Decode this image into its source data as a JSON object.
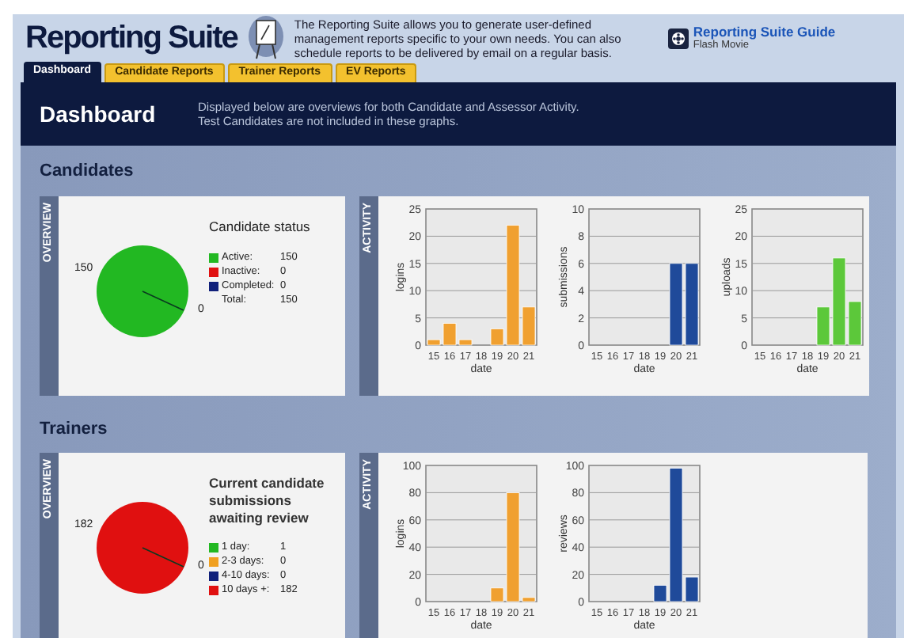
{
  "header": {
    "title": "Reporting Suite",
    "description": "The Reporting Suite allows you to generate user-defined\nmanagement reports specific to your own needs. You can also\nschedule reports to be delivered by email on a regular basis.",
    "guide_link": "Reporting Suite Guide",
    "guide_subtitle": "Flash Movie"
  },
  "tabs": [
    {
      "label": "Dashboard",
      "selected": true
    },
    {
      "label": "Candidate Reports",
      "selected": false
    },
    {
      "label": "Trainer Reports",
      "selected": false
    },
    {
      "label": "EV Reports",
      "selected": false
    }
  ],
  "banner": {
    "title": "Dashboard",
    "description": "Displayed below are overviews for both Candidate and Assessor Activity.\nTest Candidates are not included in these graphs."
  },
  "sections": [
    {
      "title": "Candidates",
      "overview": {
        "label": "OVERVIEW",
        "pie_labels": [
          "150",
          "0"
        ],
        "legend_title": "Candidate status",
        "legend": [
          {
            "label": "Active:",
            "value": "150",
            "color": "#22b822"
          },
          {
            "label": "Inactive:",
            "value": "0",
            "color": "#e01010"
          },
          {
            "label": "Completed:",
            "value": "0",
            "color": "#10207a"
          }
        ],
        "total": {
          "label": "Total:",
          "value": "150"
        }
      },
      "activity": {
        "label": "ACTIVITY",
        "charts": [
          {
            "chart_data": {
              "type": "bar",
              "xlabel": "date",
              "ylabel": "logins",
              "categories": [
                "15",
                "16",
                "17",
                "18",
                "19",
                "20",
                "21"
              ],
              "series": [
                {
                  "color": "#f0a030",
                  "values": [
                    1,
                    4,
                    1,
                    0,
                    3,
                    22,
                    7
                  ]
                }
              ],
              "grid": true,
              "ylim": [
                0,
                25
              ],
              "yticks": [
                0,
                5,
                10,
                15,
                20,
                25
              ]
            }
          },
          {
            "chart_data": {
              "type": "bar",
              "xlabel": "date",
              "ylabel": "submissions",
              "categories": [
                "15",
                "16",
                "17",
                "18",
                "19",
                "20",
                "21"
              ],
              "series": [
                {
                  "color": "#1f4a9a",
                  "values": [
                    0,
                    0,
                    0,
                    0,
                    0,
                    6,
                    6
                  ]
                }
              ],
              "grid": true,
              "ylim": [
                0,
                10
              ],
              "yticks": [
                0,
                2,
                4,
                6,
                8,
                10
              ]
            }
          },
          {
            "chart_data": {
              "type": "bar",
              "xlabel": "date",
              "ylabel": "uploads",
              "categories": [
                "15",
                "16",
                "17",
                "18",
                "19",
                "20",
                "21"
              ],
              "series": [
                {
                  "color": "#5cc83a",
                  "values": [
                    0,
                    0,
                    0,
                    0,
                    7,
                    16,
                    8
                  ]
                }
              ],
              "grid": true,
              "ylim": [
                0,
                25
              ],
              "yticks": [
                0,
                5,
                10,
                15,
                20,
                25
              ]
            }
          }
        ]
      }
    },
    {
      "title": "Trainers",
      "overview": {
        "label": "OVERVIEW",
        "pie_labels": [
          "182",
          "0"
        ],
        "legend_title": "Current candidate submissions awaiting review",
        "legend": [
          {
            "label": "1 day:",
            "value": "1",
            "color": "#22b822"
          },
          {
            "label": "2-3 days:",
            "value": "0",
            "color": "#f0a020"
          },
          {
            "label": "4-10 days:",
            "value": "0",
            "color": "#10207a"
          },
          {
            "label": "10 days +:",
            "value": "182",
            "color": "#e01010"
          }
        ]
      },
      "activity": {
        "label": "ACTIVITY",
        "charts": [
          {
            "chart_data": {
              "type": "bar",
              "xlabel": "date",
              "ylabel": "logins",
              "categories": [
                "15",
                "16",
                "17",
                "18",
                "19",
                "20",
                "21"
              ],
              "series": [
                {
                  "color": "#f0a030",
                  "values": [
                    0,
                    0,
                    0,
                    0,
                    10,
                    80,
                    3
                  ]
                }
              ],
              "grid": true,
              "ylim": [
                0,
                100
              ],
              "yticks": [
                0,
                20,
                40,
                60,
                80,
                100
              ]
            }
          },
          {
            "chart_data": {
              "type": "bar",
              "xlabel": "date",
              "ylabel": "reviews",
              "categories": [
                "15",
                "16",
                "17",
                "18",
                "19",
                "20",
                "21"
              ],
              "series": [
                {
                  "color": "#1f4a9a",
                  "values": [
                    0,
                    0,
                    0,
                    0,
                    12,
                    98,
                    18
                  ]
                }
              ],
              "grid": true,
              "ylim": [
                0,
                100
              ],
              "yticks": [
                0,
                20,
                40,
                60,
                80,
                100
              ]
            }
          }
        ]
      }
    }
  ]
}
